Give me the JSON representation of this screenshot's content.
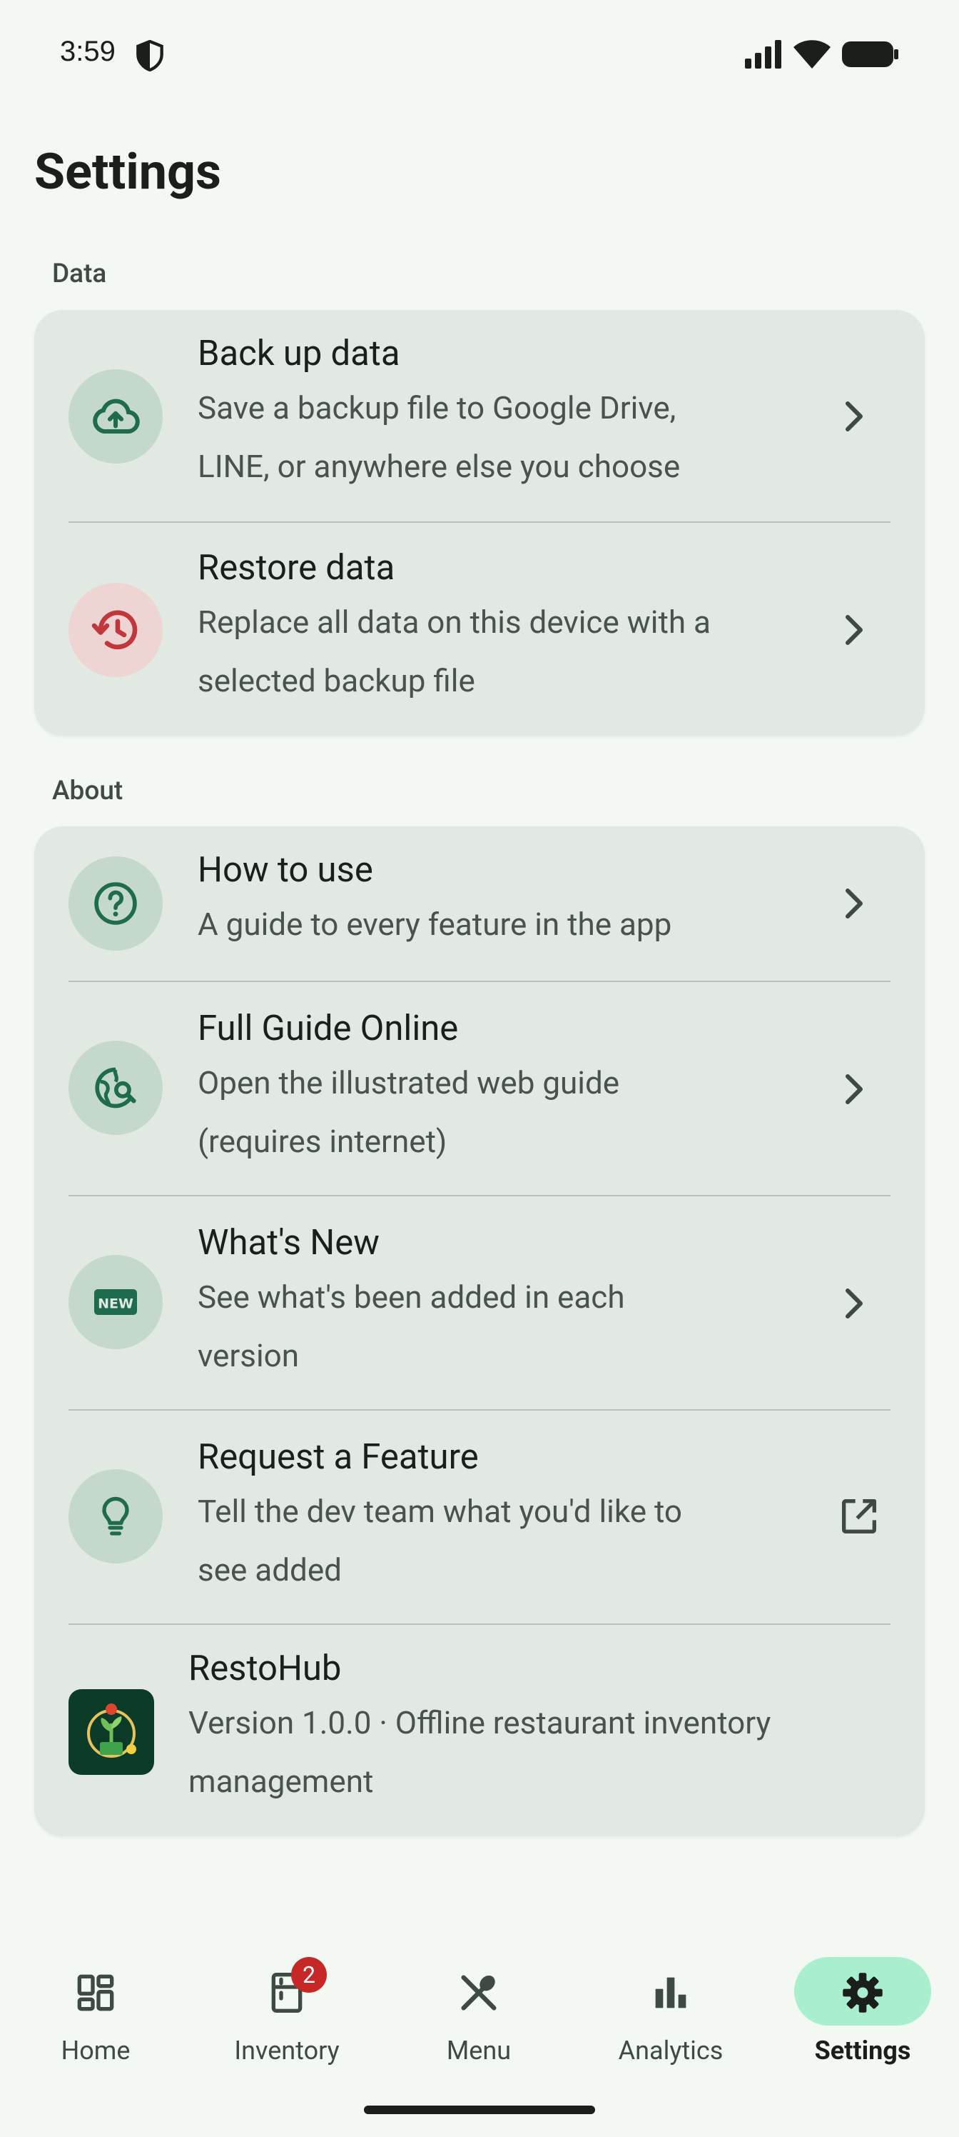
{
  "status_bar": {
    "time": "3:59"
  },
  "page": {
    "title": "Settings"
  },
  "sections": {
    "data": {
      "label": "Data",
      "items": [
        {
          "title": "Back up data",
          "line1": "Save a backup file to Google Drive,",
          "line2": "LINE, or anywhere else you choose",
          "icon": "cloud-upload-icon",
          "trailing": "chevron-right-icon"
        },
        {
          "title": "Restore data",
          "line1": "Replace all data on this device with a",
          "line2": "selected backup file",
          "icon": "restore-history-icon",
          "trailing": "chevron-right-icon"
        }
      ]
    },
    "about": {
      "label": "About",
      "items": [
        {
          "title": "How to use",
          "line1": "A guide to every feature in the app",
          "icon": "help-circle-icon",
          "trailing": "chevron-right-icon"
        },
        {
          "title": "Full Guide Online",
          "line1": "Open the illustrated web guide",
          "line2": "(requires internet)",
          "icon": "travel-explore-icon",
          "trailing": "chevron-right-icon"
        },
        {
          "title": "What's New",
          "line1": "See what's been added in each",
          "line2": "version",
          "icon": "new-releases-icon",
          "icon_text": "NEW",
          "trailing": "chevron-right-icon"
        },
        {
          "title": "Request a Feature",
          "line1": "Tell the dev team what you'd like to",
          "line2": "see added",
          "icon": "lightbulb-icon",
          "trailing": "open-in-new-icon"
        },
        {
          "title": "RestoHub",
          "line1": "Version 1.0.0 · Offline restaurant inventory",
          "line2": "management",
          "icon": "app-logo"
        }
      ]
    }
  },
  "bottom_nav": {
    "items": [
      {
        "label": "Home",
        "icon": "dashboard-icon",
        "active": false
      },
      {
        "label": "Inventory",
        "icon": "fridge-icon",
        "badge": "2",
        "active": false
      },
      {
        "label": "Menu",
        "icon": "restaurant-icon",
        "active": false
      },
      {
        "label": "Analytics",
        "icon": "bar-chart-icon",
        "active": false
      },
      {
        "label": "Settings",
        "icon": "gear-icon",
        "active": true
      }
    ]
  },
  "colors": {
    "background": "#f3f8f3",
    "card": "#e2e9e3",
    "accent_green": "#1e6b4e",
    "accent_red": "#c0373c",
    "nav_active_pill": "#a9efcf",
    "badge": "#c62828"
  }
}
